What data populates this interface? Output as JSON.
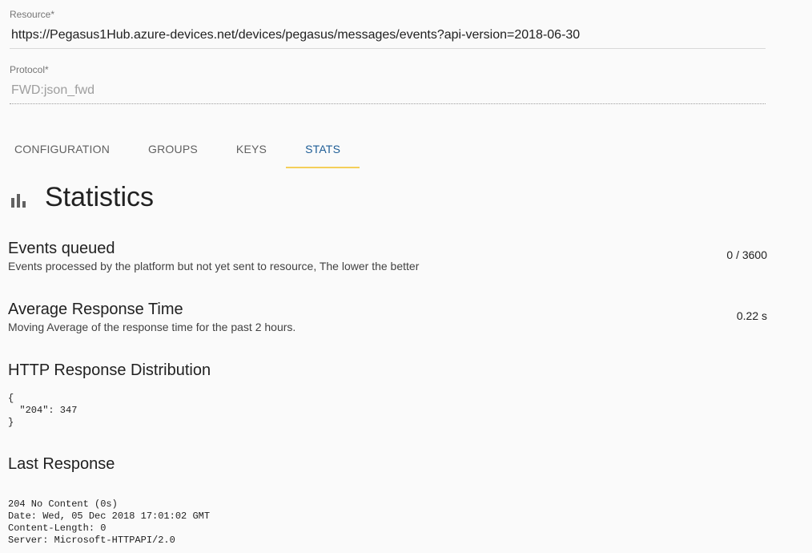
{
  "resource": {
    "label": "Resource",
    "required_mark": "*",
    "value": "https://Pegasus1Hub.azure-devices.net/devices/pegasus/messages/events?api-version=2018-06-30"
  },
  "protocol": {
    "label": "Protocol",
    "required_mark": "*",
    "value": "FWD:json_fwd"
  },
  "tabs": [
    {
      "label": "CONFIGURATION",
      "active": false
    },
    {
      "label": "GROUPS",
      "active": false
    },
    {
      "label": "KEYS",
      "active": false
    },
    {
      "label": "STATS",
      "active": true
    }
  ],
  "colors": {
    "accent": "#1e5d96",
    "tab_indicator": "#f5cf5a",
    "background": "#fafafa"
  },
  "page_heading": {
    "icon": "bar-chart-icon",
    "title": "Statistics"
  },
  "stats": {
    "events_queued": {
      "title": "Events queued",
      "description": "Events processed by the platform but not yet sent to resource, The lower the better",
      "value": "0 / 3600"
    },
    "average_response_time": {
      "title": "Average Response Time",
      "description": "Moving Average of the response time for the past 2 hours.",
      "value": "0.22 s"
    }
  },
  "http_distribution": {
    "title": "HTTP Response Distribution",
    "json_text": "{\n  \"204\": 347\n}"
  },
  "last_response": {
    "title": "Last Response",
    "text": "204 No Content (0s)\nDate: Wed, 05 Dec 2018 17:01:02 GMT\nContent-Length: 0\nServer: Microsoft-HTTPAPI/2.0"
  }
}
